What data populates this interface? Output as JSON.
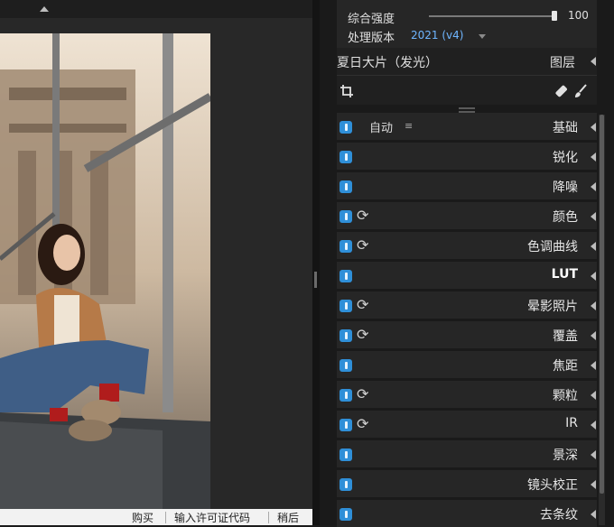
{
  "top_panel": {
    "strength_label": "综合强度",
    "strength_value": "100",
    "strength_level": 1.0,
    "version_label": "处理版本",
    "version_value": "2021 (v4)"
  },
  "preset_row": {
    "preset_name": "夏日大片（发光）",
    "layers_label": "图层"
  },
  "toolbar": {
    "crop_icon": "crop-icon",
    "eraser_icon": "eraser-icon",
    "brush_icon": "brush-icon"
  },
  "modules": [
    {
      "name": "基础",
      "auto_label": "自动",
      "has_menu": true,
      "sync": false
    },
    {
      "name": "锐化",
      "sync": false
    },
    {
      "name": "降噪",
      "sync": false
    },
    {
      "name": "颜色",
      "sync": true
    },
    {
      "name": "色调曲线",
      "sync": true
    },
    {
      "name": "LUT",
      "sync": false
    },
    {
      "name": "晕影照片",
      "sync": true
    },
    {
      "name": "覆盖",
      "sync": true
    },
    {
      "name": "焦距",
      "sync": false
    },
    {
      "name": "颗粒",
      "sync": true
    },
    {
      "name": "IR",
      "sync": true
    },
    {
      "name": "景深",
      "sync": false
    },
    {
      "name": "镜头校正",
      "sync": false
    },
    {
      "name": "去条纹",
      "sync": false
    }
  ],
  "bottom_bar": {
    "buy": "购买",
    "license": "输入许可证代码",
    "later": "稍后"
  },
  "colors": {
    "toggle_blue": "#2f8fd8",
    "version_blue": "#6fb6ff"
  }
}
